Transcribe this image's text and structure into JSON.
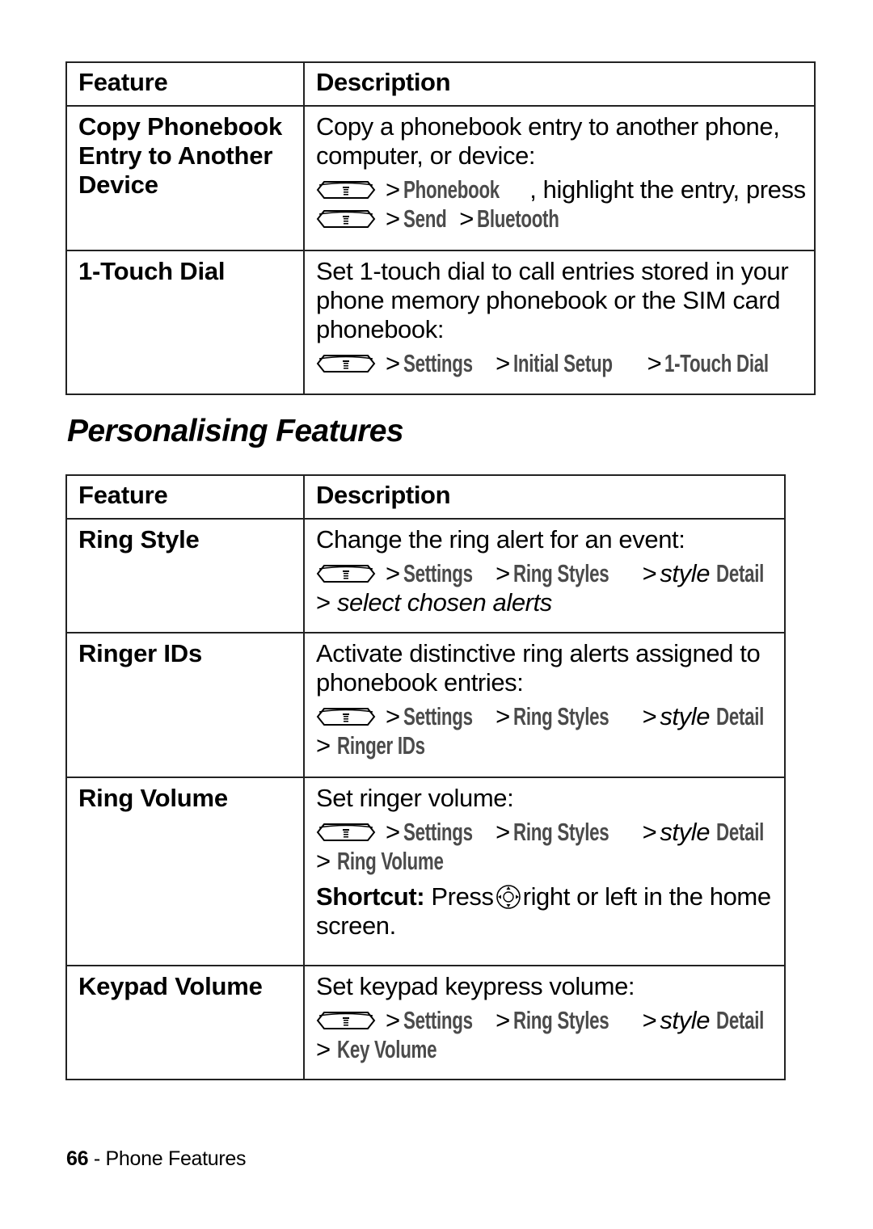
{
  "table1": {
    "header": {
      "feature": "Feature",
      "description": "Description"
    },
    "rows": [
      {
        "feature": "Copy Phonebook Entry to Another Device",
        "feature_lines": [
          "Copy Phonebook",
          "Entry to Another",
          "Device"
        ],
        "description": "Copy a phonebook entry to another phone, computer, or device:",
        "path_line1": {
          "item1": "Phonebook",
          "trail": ", highlight the entry, press"
        },
        "path_line2": {
          "item1": "Send",
          "item2": "Bluetooth"
        }
      },
      {
        "feature": "1-Touch Dial",
        "description": "Set 1-touch dial to call entries stored in your phone memory phonebook or the SIM card phonebook:",
        "path": {
          "item1": "Settings",
          "item2": "Initial Setup",
          "item3": "1-Touch Dial"
        }
      }
    ]
  },
  "section_title": "Personalising Features",
  "table2": {
    "header": {
      "feature": "Feature",
      "description": "Description"
    },
    "rows": [
      {
        "feature": "Ring Style",
        "description": "Change the ring alert for an event:",
        "path": {
          "item1": "Settings",
          "item2": "Ring Styles",
          "item3_italic": "style",
          "item3": "Detail",
          "last_italic": "select chosen alerts"
        }
      },
      {
        "feature": "Ringer IDs",
        "description": "Activate distinctive ring alerts assigned to phonebook entries:",
        "path": {
          "item1": "Settings",
          "item2": "Ring Styles",
          "item3_italic": "style",
          "item3": "Detail",
          "last": "Ringer IDs"
        }
      },
      {
        "feature": "Ring Volume",
        "description": "Set ringer volume:",
        "path": {
          "item1": "Settings",
          "item2": "Ring Styles",
          "item3_italic": "style",
          "item3": "Detail",
          "last": "Ring Volume"
        },
        "shortcut": {
          "label": "Shortcut:",
          "before": "Press",
          "after": "right or left in the home screen."
        }
      },
      {
        "feature": "Keypad Volume",
        "description": "Set keypad keypress volume:",
        "path": {
          "item1": "Settings",
          "item2": "Ring Styles",
          "item3_italic": "style",
          "item3": "Detail",
          "last": "Key Volume"
        }
      }
    ]
  },
  "separator": ">",
  "icons": {
    "menu_key": "menu-key-icon",
    "nav_key": "navigation-key-icon"
  },
  "footer": {
    "page_number": "66",
    "dash": " - ",
    "section": "Phone Features"
  }
}
